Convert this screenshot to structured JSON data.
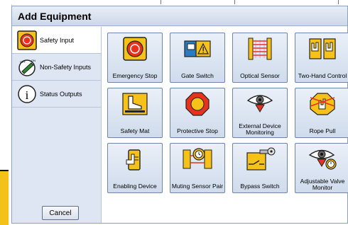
{
  "dialog": {
    "title": "Add Equipment",
    "cancel_label": "Cancel"
  },
  "categories": [
    {
      "label": "Safety Input",
      "icon": "emergency-stop-icon",
      "selected": true
    },
    {
      "label": "Non-Safety Inputs",
      "icon": "selector-switch-icon",
      "selected": false
    },
    {
      "label": "Status Outputs",
      "icon": "info-icon",
      "selected": false
    }
  ],
  "equipment": [
    {
      "label": "Emergency Stop",
      "icon": "emergency-stop-icon"
    },
    {
      "label": "Gate Switch",
      "icon": "gate-switch-icon"
    },
    {
      "label": "Optical Sensor",
      "icon": "optical-sensor-icon"
    },
    {
      "label": "Two-Hand Control",
      "icon": "two-hand-control-icon"
    },
    {
      "label": "Safety Mat",
      "icon": "safety-mat-icon"
    },
    {
      "label": "Protective Stop",
      "icon": "protective-stop-icon"
    },
    {
      "label": "External Device Monitoring",
      "icon": "external-device-monitoring-icon"
    },
    {
      "label": "Rope Pull",
      "icon": "rope-pull-icon"
    },
    {
      "label": "Enabling Device",
      "icon": "enabling-device-icon"
    },
    {
      "label": "Muting Sensor Pair",
      "icon": "muting-sensor-pair-icon"
    },
    {
      "label": "Bypass Switch",
      "icon": "bypass-switch-icon"
    },
    {
      "label": "Adjustable Valve Monitor",
      "icon": "adjustable-valve-monitor-icon"
    }
  ],
  "colors": {
    "sidebar_bg": "#dde6f2",
    "tile_bg": "#cfdbec",
    "accent_yellow": "#f6c21a",
    "alert_red": "#e8321c"
  }
}
